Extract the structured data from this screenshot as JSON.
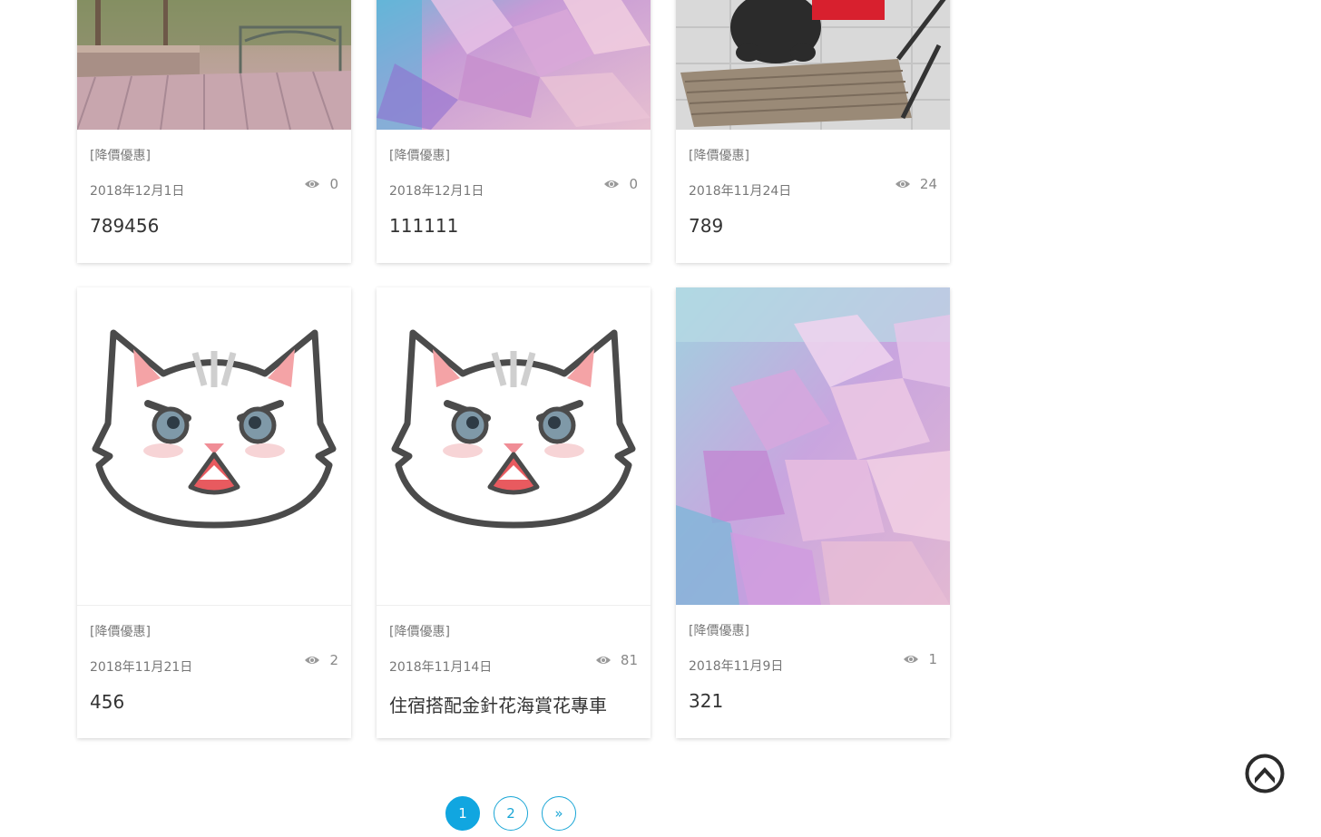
{
  "cards": [
    {
      "tag": "[降價優惠]",
      "date": "2018年12月1日",
      "views": "0",
      "title": "789456",
      "image": "garden-deck-photo"
    },
    {
      "tag": "[降價優惠]",
      "date": "2018年12月1日",
      "views": "0",
      "title": "111111",
      "image": "pink-crystal-photo"
    },
    {
      "tag": "[降價優惠]",
      "date": "2018年11月24日",
      "views": "24",
      "title": "789",
      "image": "poodle-on-chair-photo"
    },
    {
      "tag": "[降價優惠]",
      "date": "2018年11月21日",
      "views": "2",
      "title": "456",
      "image": "angry-cat-illustration"
    },
    {
      "tag": "[降價優惠]",
      "date": "2018年11月14日",
      "views": "81",
      "title": "住宿搭配金針花海賞花專車",
      "image": "angry-cat-illustration"
    },
    {
      "tag": "[降價優惠]",
      "date": "2018年11月9日",
      "views": "1",
      "title": "321",
      "image": "pink-crystal-photo"
    }
  ],
  "pagination": {
    "pages": [
      "1",
      "2"
    ],
    "next": "»",
    "current": "1"
  },
  "icons": {
    "views": "eye-icon",
    "back_to_top": "chevron-up-circle-icon"
  },
  "colors": {
    "accent": "#11a6e0",
    "muted_text": "#777777"
  }
}
